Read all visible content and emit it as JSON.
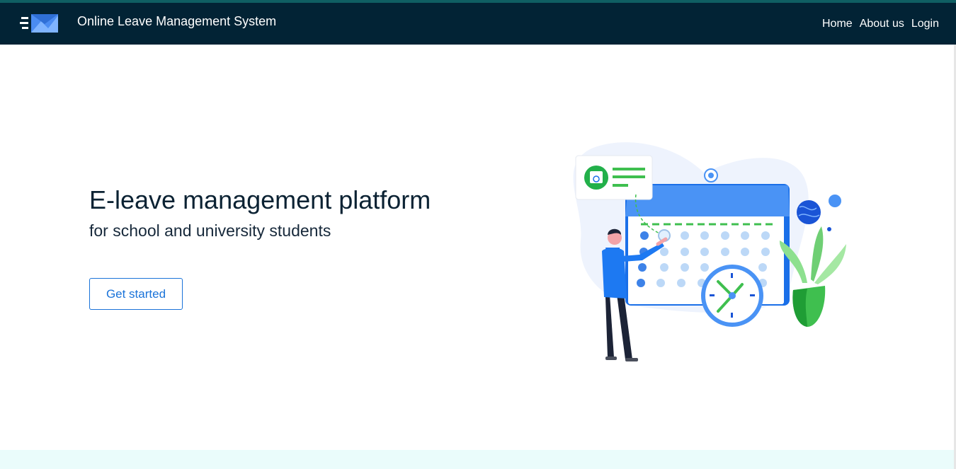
{
  "navbar": {
    "title": "Online Leave Management System",
    "links": [
      "Home",
      "About us",
      "Login"
    ]
  },
  "hero": {
    "title": "E-leave management platform",
    "subtitle": "for school and university students",
    "cta_label": "Get started"
  },
  "colors": {
    "navbar_bg": "#022335",
    "accent_blue": "#1a73d9",
    "footer_band": "#eafcfb"
  },
  "icons": {
    "logo": "envelope-logo-icon",
    "illustration": "calendar-scheduling-illustration"
  }
}
